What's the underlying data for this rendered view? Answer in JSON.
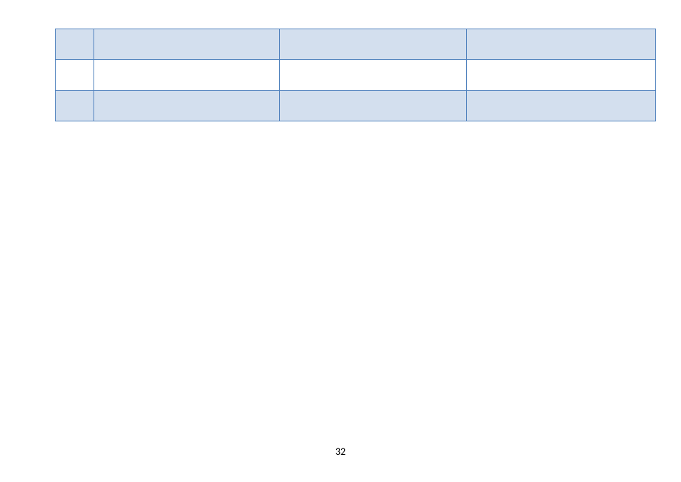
{
  "page_number": "32",
  "table": {
    "rows": [
      {
        "shaded": true,
        "cells": [
          "",
          "",
          "",
          ""
        ]
      },
      {
        "shaded": false,
        "cells": [
          "",
          "",
          "",
          ""
        ]
      },
      {
        "shaded": true,
        "cells": [
          "",
          "",
          "",
          ""
        ]
      }
    ]
  }
}
